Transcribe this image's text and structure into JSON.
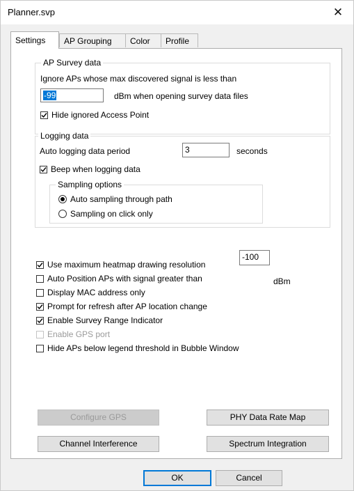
{
  "window": {
    "title": "Planner.svp",
    "close_glyph": "✕"
  },
  "tabs": [
    {
      "label": "Settings",
      "active": true
    },
    {
      "label": "AP Grouping",
      "active": false
    },
    {
      "label": "Color",
      "active": false
    },
    {
      "label": "Profile",
      "active": false
    }
  ],
  "ap_survey": {
    "legend": "AP Survey data",
    "ignore_text": "Ignore APs whose max discovered signal is less than",
    "threshold_value": "-99",
    "threshold_unit": "dBm when opening survey data files",
    "hide_ignored_label": "Hide ignored Access Point",
    "hide_ignored_checked": true
  },
  "logging": {
    "legend": "Logging data",
    "period_label": "Auto logging data period",
    "period_value": "3",
    "period_unit": "seconds",
    "beep_label": "Beep when logging data",
    "beep_checked": true,
    "sampling": {
      "legend": "Sampling options",
      "auto_label": "Auto sampling through path",
      "click_label": "Sampling on click only",
      "selected": "auto"
    }
  },
  "options": {
    "max_heatmap_label": "Use maximum heatmap drawing resolution",
    "max_heatmap_checked": true,
    "auto_position_label": "Auto Position APs with signal greater than",
    "auto_position_checked": false,
    "auto_position_value": "-100",
    "auto_position_unit": "dBm",
    "mac_only_label": "Display MAC address only",
    "mac_only_checked": false,
    "prompt_refresh_label": "Prompt for refresh after AP location change",
    "prompt_refresh_checked": true,
    "survey_range_label": "Enable Survey Range Indicator",
    "survey_range_checked": true,
    "gps_port_label": "Enable GPS port",
    "gps_port_checked": false,
    "hide_below_label": "Hide APs below legend threshold in Bubble Window",
    "hide_below_checked": false
  },
  "buttons": {
    "configure_gps": "Configure GPS",
    "phy_rate_map": "PHY Data Rate Map",
    "channel_interference": "Channel Interference",
    "spectrum_integration": "Spectrum Integration",
    "ok": "OK",
    "cancel": "Cancel"
  }
}
